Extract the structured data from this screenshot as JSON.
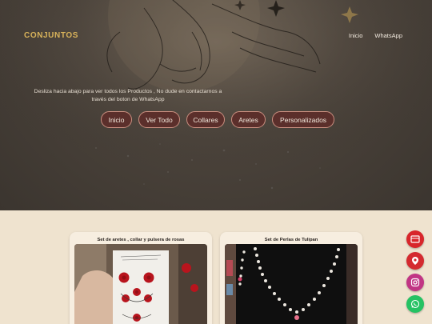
{
  "brand": {
    "name": "CONJUNTOS"
  },
  "nav": {
    "items": [
      "Inicio",
      "WhatsApp"
    ]
  },
  "hero": {
    "text": "Desliza hacia abajo para ver todos los Productos , No dude en contactarnos a través del boton de WhatsApp"
  },
  "categories": [
    "Inicio",
    "Ver Todo",
    "Collares",
    "Aretes",
    "Personalizados"
  ],
  "products": [
    {
      "title": "Set de aretes , collar y pulsera de rosas"
    },
    {
      "title": "Set de Perlas de Tulipan"
    }
  ],
  "floating": [
    {
      "icon": "catalog-icon",
      "color": "#d8262b"
    },
    {
      "icon": "location-pin-icon",
      "color": "#d42a2f"
    },
    {
      "icon": "instagram-icon",
      "color": "#c13584"
    },
    {
      "icon": "whatsapp-icon",
      "color": "#25c263"
    }
  ]
}
